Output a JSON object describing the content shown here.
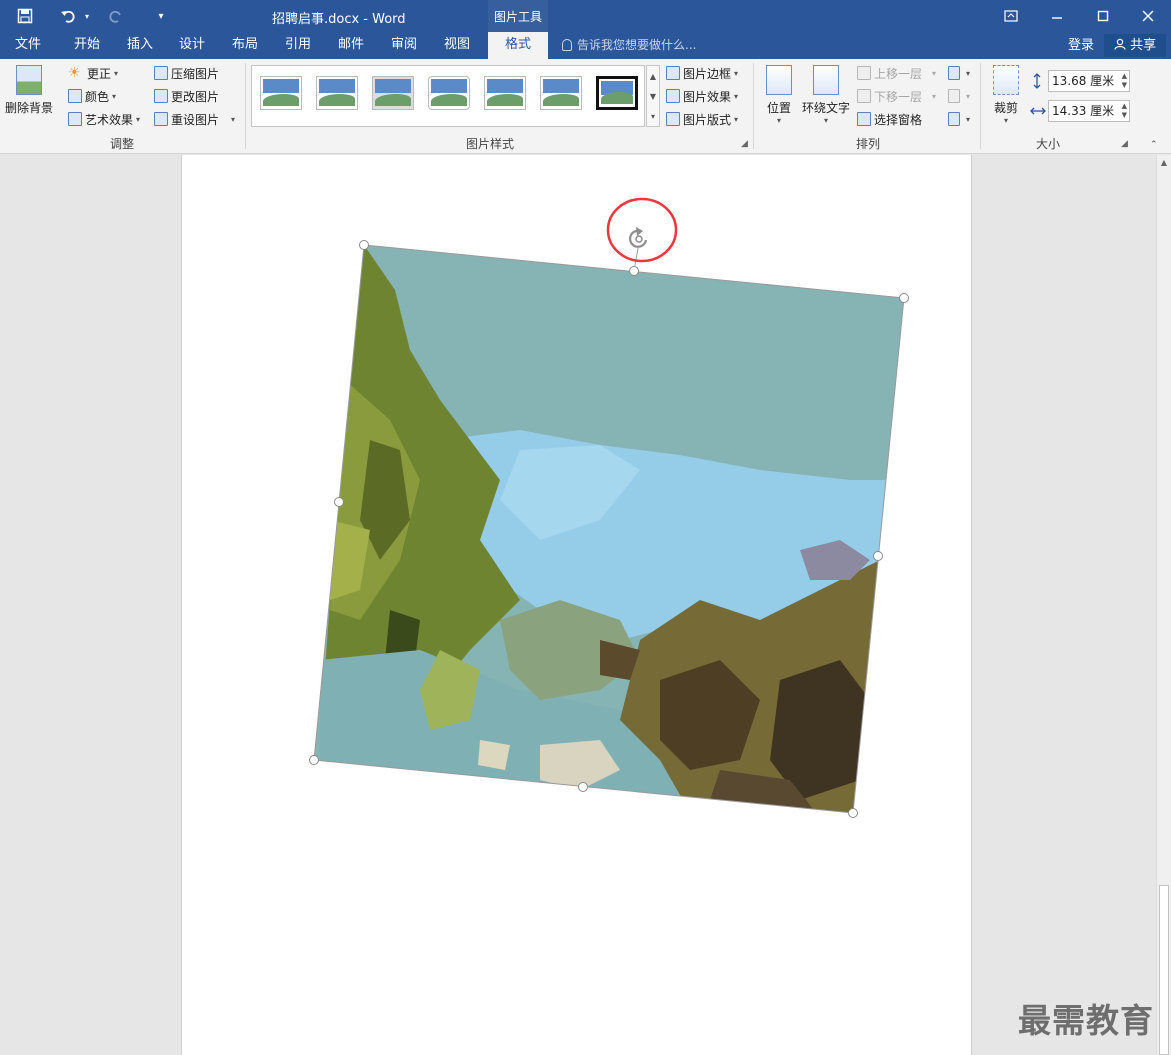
{
  "titlebar": {
    "document_title": "招聘启事.docx - Word",
    "context_tools": "图片工具",
    "quick_access": {
      "save": "save-icon",
      "undo": "undo-icon",
      "redo": "redo-icon",
      "customize": "customize-icon"
    }
  },
  "tabs": [
    {
      "label": "文件"
    },
    {
      "label": "开始"
    },
    {
      "label": "插入"
    },
    {
      "label": "设计"
    },
    {
      "label": "布局"
    },
    {
      "label": "引用"
    },
    {
      "label": "邮件"
    },
    {
      "label": "审阅"
    },
    {
      "label": "视图"
    },
    {
      "label": "格式"
    }
  ],
  "active_tab": "格式",
  "tell_me": "告诉我您想要做什么...",
  "account": {
    "login": "登录",
    "share": "共享"
  },
  "ribbon": {
    "adjust": {
      "label": "调整",
      "remove_bg": "删除背景",
      "corrections": "更正",
      "color": "颜色",
      "artistic": "艺术效果",
      "compress": "压缩图片",
      "change": "更改图片",
      "reset": "重设图片"
    },
    "styles": {
      "label": "图片样式",
      "border": "图片边框",
      "effects": "图片效果",
      "layout": "图片版式"
    },
    "arrange": {
      "label": "排列",
      "position": "位置",
      "wrap": "环绕文字",
      "forward": "上移一层",
      "backward": "下移一层",
      "selection_pane": "选择窗格"
    },
    "size": {
      "label": "大小",
      "crop": "裁剪",
      "height": "13.68 厘米",
      "width": "14.33 厘米"
    }
  },
  "watermark": "最需教育",
  "colors": {
    "ribbon_blue": "#2b579a",
    "highlight_circle": "#e8383d"
  }
}
